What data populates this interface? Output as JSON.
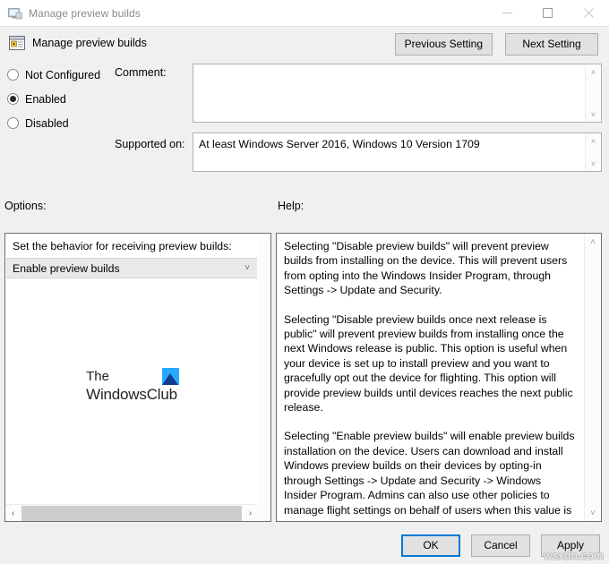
{
  "window": {
    "title": "Manage preview builds",
    "icon": "monitor-policy-icon",
    "controls": {
      "minimize": "—",
      "maximize": "☐",
      "close": "✕"
    }
  },
  "header": {
    "title": "Manage preview builds",
    "icon": "policy-setting-icon",
    "previous_setting": "Previous Setting",
    "next_setting": "Next Setting"
  },
  "state": {
    "options": [
      {
        "label": "Not Configured",
        "selected": false
      },
      {
        "label": "Enabled",
        "selected": true
      },
      {
        "label": "Disabled",
        "selected": false
      }
    ]
  },
  "comment": {
    "label": "Comment:",
    "value": "",
    "placeholder": ""
  },
  "supported_on": {
    "label": "Supported on:",
    "value": "At least Windows Server 2016, Windows 10 Version 1709"
  },
  "options_panel": {
    "label": "Options:",
    "caption": "Set the behavior for receiving preview builds:",
    "dropdown": {
      "value": "Enable preview builds",
      "arrow": "˅"
    },
    "watermark": {
      "line1": "The",
      "line2": "WindowsClub",
      "logo": "windowsclub-logo-icon",
      "logo_color": "#29a8ff"
    },
    "scrollbar": {
      "left_arrow": "‹",
      "right_arrow": "›"
    }
  },
  "help_panel": {
    "label": "Help:",
    "paragraphs": [
      "Selecting \"Disable preview builds\" will prevent preview builds from installing on the device. This will prevent users from opting into the Windows Insider Program, through Settings -> Update and Security.",
      "Selecting \"Disable preview builds once next release is public\" will prevent preview builds from installing once the next Windows release is public. This option is useful when your device is set up to install preview and you want to gracefully opt out the device for flighting. This option will provide preview builds until devices reaches the next public release.",
      "Selecting \"Enable preview builds\" will enable preview builds installation on the device. Users can download and install Windows preview builds on their devices by opting-in through Settings -> Update and Security -> Windows Insider Program. Admins can also use other policies to manage flight settings on behalf of users when this value is set."
    ],
    "scrollbar": {
      "up_arrow": "˄",
      "down_arrow": "˅"
    }
  },
  "footer": {
    "ok": "OK",
    "cancel": "Cancel",
    "apply": "Apply",
    "default_button_color": "#0078d7"
  },
  "scroll_glyphs": {
    "up": "˄",
    "down": "˅"
  },
  "page_watermark": "wsxdn.com"
}
